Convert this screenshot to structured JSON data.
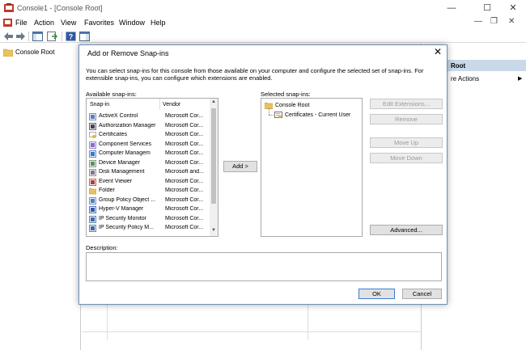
{
  "window": {
    "title": "Console1 - [Console Root]",
    "controls": {
      "minimize": "—",
      "maximize": "☐",
      "close": "✕"
    },
    "doc_controls": {
      "minimize": "—",
      "restore": "❐",
      "close": "✕"
    }
  },
  "menu": {
    "items": [
      "File",
      "Action",
      "View",
      "Favorites",
      "Window",
      "Help"
    ]
  },
  "toolbar": {
    "icons": [
      "back-arrow-icon",
      "forward-arrow-icon",
      "show-hide-tree-icon",
      "export-list-icon",
      "help-icon",
      "show-hide-action-pane-icon"
    ]
  },
  "tree": {
    "root_label": "Console Root"
  },
  "actions": {
    "title": "Root",
    "more_actions": "re Actions",
    "arrow": "▶"
  },
  "dialog": {
    "title": "Add or Remove Snap-ins",
    "close": "✕",
    "description": "You can select snap-ins for this console from those available on your computer and configure the selected set of snap-ins. For extensible snap-ins, you can configure which extensions are enabled.",
    "available_label": "Available snap-ins:",
    "selected_label": "Selected snap-ins:",
    "description_label": "Description:",
    "columns": {
      "snapin": "Snap-in",
      "vendor": "Vendor"
    },
    "snapins": [
      {
        "name": "ActiveX Control",
        "vendor": "Microsoft Cor...",
        "icon": "activex-icon"
      },
      {
        "name": "Authorization Manager",
        "vendor": "Microsoft Cor...",
        "icon": "authorization-icon"
      },
      {
        "name": "Certificates",
        "vendor": "Microsoft Cor...",
        "icon": "certificates-icon"
      },
      {
        "name": "Component Services",
        "vendor": "Microsoft Cor...",
        "icon": "component-services-icon"
      },
      {
        "name": "Computer Managem",
        "vendor": "Microsoft Cor...",
        "icon": "computer-management-icon"
      },
      {
        "name": "Device Manager",
        "vendor": "Microsoft Cor...",
        "icon": "device-manager-icon"
      },
      {
        "name": "Disk Management",
        "vendor": "Microsoft and...",
        "icon": "disk-management-icon"
      },
      {
        "name": "Event Viewer",
        "vendor": "Microsoft Cor...",
        "icon": "event-viewer-icon"
      },
      {
        "name": "Folder",
        "vendor": "Microsoft Cor...",
        "icon": "folder-icon"
      },
      {
        "name": "Group Policy Object ...",
        "vendor": "Microsoft Cor...",
        "icon": "group-policy-icon"
      },
      {
        "name": "Hyper-V Manager",
        "vendor": "Microsoft Cor...",
        "icon": "hyper-v-icon"
      },
      {
        "name": "IP Security Monitor",
        "vendor": "Microsoft Cor...",
        "icon": "ip-security-monitor-icon"
      },
      {
        "name": "IP Security Policy M...",
        "vendor": "Microsoft Cor...",
        "icon": "ip-security-policy-icon"
      }
    ],
    "selected_tree": {
      "root": "Console Root",
      "child": "Certificates - Current User"
    },
    "buttons": {
      "add": "Add >",
      "edit_extensions": "Edit Extensions...",
      "remove": "Remove",
      "move_up": "Move Up",
      "move_down": "Move Down",
      "advanced": "Advanced...",
      "ok": "OK",
      "cancel": "Cancel"
    }
  }
}
